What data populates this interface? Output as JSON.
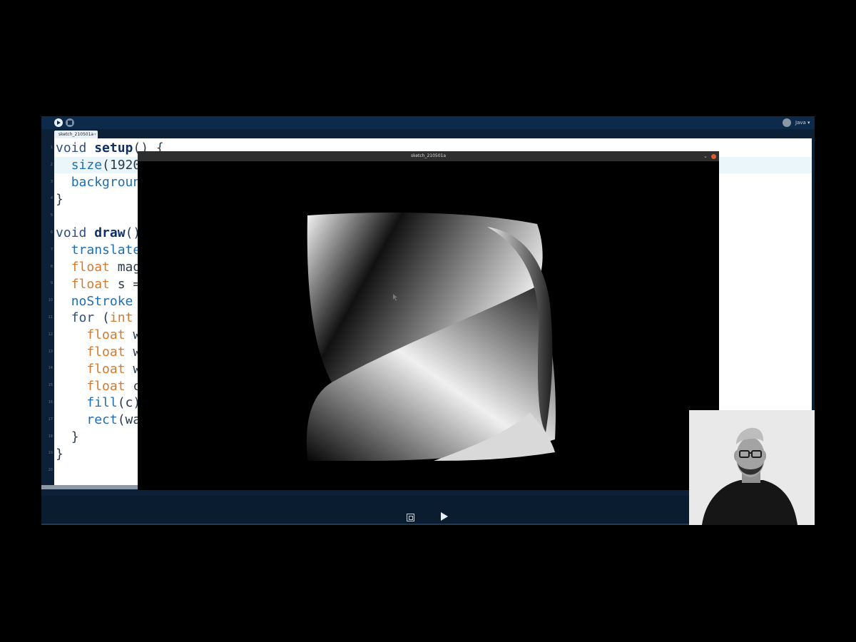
{
  "ide": {
    "tab_label": "sketch_210501a",
    "mode_label": "Java ▾",
    "line_numbers": [
      "1",
      "2",
      "3",
      "4",
      "5",
      "6",
      "7",
      "8",
      "9",
      "10",
      "11",
      "12",
      "13",
      "14",
      "15",
      "16",
      "17",
      "18",
      "19",
      "20"
    ]
  },
  "code": {
    "l1_kw": "void",
    "l1_fn": "setup",
    "l1_rest": "() {",
    "l2_fn": "size",
    "l2_rest": "(1920",
    "l3_fn": "backgroun",
    "l4": "}",
    "l6_kw": "void",
    "l6_fn": "draw",
    "l6_rest": "()",
    "l7_fn": "translate",
    "l8_ty": "float",
    "l8_rest": " mag",
    "l9_ty": "float",
    "l9_rest": " s =",
    "l10_fn": "noStroke",
    "l11_kw": "for",
    "l11_rest": " (",
    "l11_ty": "int",
    "l12_ty": "float",
    "l12_rest": " w",
    "l13_ty": "float",
    "l13_rest": " w",
    "l14_ty": "float",
    "l14_rest": " w",
    "l15_ty": "float",
    "l15_rest": " c",
    "l16_fn": "fill",
    "l16_rest": "(c)",
    "l17_fn": "rect",
    "l17_rest": "(wa",
    "l18": "}",
    "l19": "}"
  },
  "sketch_window": {
    "title": "sketch_210501a",
    "minimize_glyph": "⌄"
  },
  "colors": {
    "ide_background": "#0c2138",
    "keyword": "#2f4f7f",
    "function": "#0f2f66",
    "type": "#d67a2e",
    "close_button": "#e05a2d"
  },
  "icons": [
    "run-icon",
    "stop-icon",
    "debug-icon",
    "console-icon",
    "play-icon",
    "close-icon",
    "minimize-icon",
    "mouse-cursor-icon"
  ]
}
